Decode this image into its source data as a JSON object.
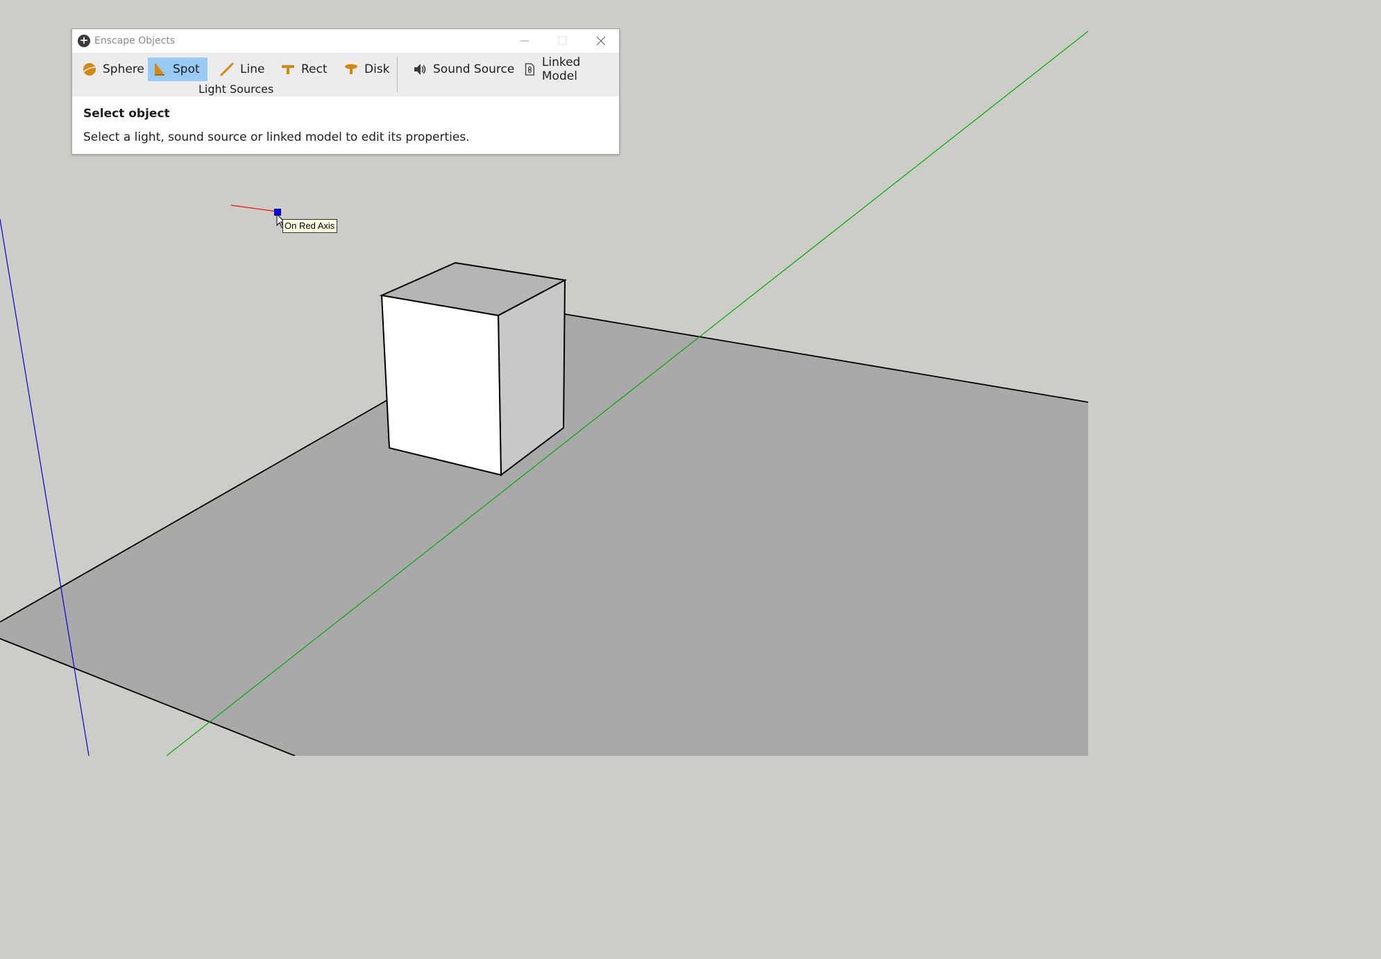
{
  "window": {
    "title": "Enscape Objects",
    "icon": "plus-circle-icon"
  },
  "toolbar": {
    "light_sources_label": "Light Sources",
    "buttons": {
      "sphere": "Sphere",
      "spot": "Spot",
      "line": "Line",
      "rect": "Rect",
      "disk": "Disk",
      "sound_source": "Sound Source",
      "linked_model": "Linked Model"
    },
    "active_tool": "Spot"
  },
  "info": {
    "heading": "Select object",
    "message": "Select a light, sound source or linked model to edit its properties."
  },
  "viewport": {
    "tooltip": "On Red Axis",
    "colors": {
      "sky": "#cccdc7",
      "ground": "#a9a9a9",
      "red_axis": "#ff0000",
      "green_axis": "#00aa00",
      "blue_axis": "#0000cc",
      "accent": "#99c9f5",
      "icon_orange": "#d4880f"
    }
  }
}
